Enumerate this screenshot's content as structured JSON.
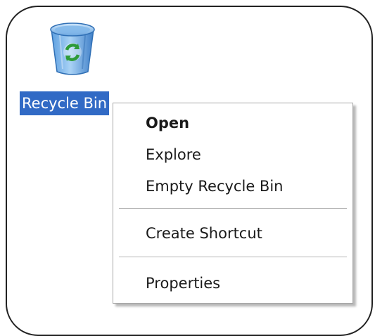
{
  "desktop": {
    "icon": {
      "name": "recycle-bin-icon",
      "label": "Recycle Bin",
      "selection_color": "#316ac5"
    }
  },
  "context_menu": {
    "items": [
      {
        "label": "Open",
        "default": true
      },
      {
        "label": "Explore"
      },
      {
        "label": "Empty Recycle Bin"
      },
      {
        "label": "Create Shortcut"
      },
      {
        "label": "Properties"
      }
    ]
  }
}
